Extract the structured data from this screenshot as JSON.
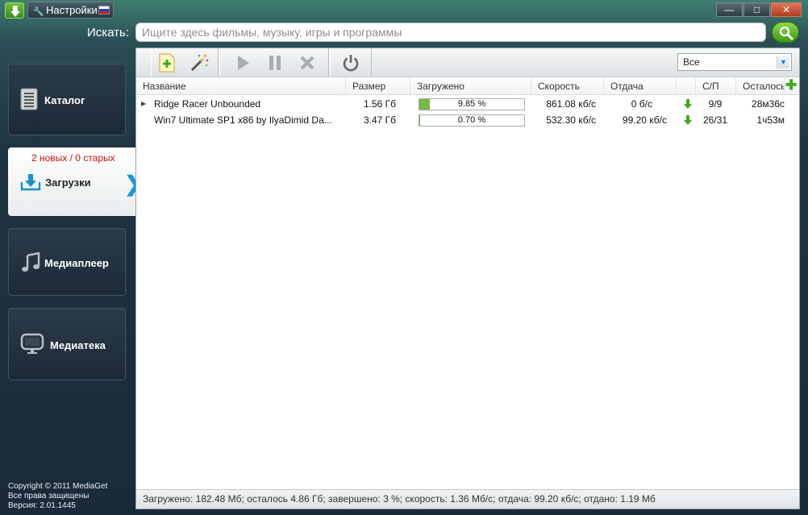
{
  "window": {
    "settings_label": "Настройки",
    "minimize": "—",
    "maximize": "□",
    "close": "✕"
  },
  "search": {
    "label": "Искать:",
    "placeholder": "Ищите здесь фильмы, музыку, игры и программы"
  },
  "sidebar": {
    "items": [
      {
        "label": "Каталог",
        "icon": "catalog-icon"
      },
      {
        "label": "Загрузки",
        "icon": "downloads-icon",
        "active": true,
        "badge": "2 новых / 0 старых"
      },
      {
        "label": "Медиаплеер",
        "icon": "music-note-icon"
      },
      {
        "label": "Медиатека",
        "icon": "monitor-icon"
      }
    ],
    "footer": {
      "copyright": "Copyright © 2011 MediaGet",
      "rights": "Все права защищены",
      "version": "Версия: 2.01.1445"
    }
  },
  "toolbar": {
    "filter_value": "Все"
  },
  "table": {
    "columns": [
      "Название",
      "Размер",
      "Загружено",
      "Скорость",
      "Отдача",
      "",
      "С/П",
      "Осталось"
    ],
    "rows": [
      {
        "name": "Ridge Racer Unbounded",
        "size": "1.56 Гб",
        "progress_text": "9.85 %",
        "progress": 0.0985,
        "speed": "861.08 кб/с",
        "upload": "0 б/с",
        "peers": "9/9",
        "remaining": "28м36с",
        "expandable": true
      },
      {
        "name": "Win7 Ultimate SP1 x86 by IlyaDimid Da...",
        "size": "3.47 Гб",
        "progress_text": "0.70 %",
        "progress": 0.007,
        "speed": "532.30 кб/с",
        "upload": "99.20 кб/с",
        "peers": "26/31",
        "remaining": "1ч53м",
        "expandable": false
      }
    ]
  },
  "status": {
    "text": "Загружено: 182.48 Мб; осталось 4.86 Гб; завершено: 3 %; скорость: 1.36 Мб/с; отдача: 99.20 кб/с; отдано: 1.19 Мб"
  },
  "colors": {
    "accent_green": "#7ab648",
    "badge_red": "#d01010",
    "chevron_blue": "#1a9ad8"
  }
}
